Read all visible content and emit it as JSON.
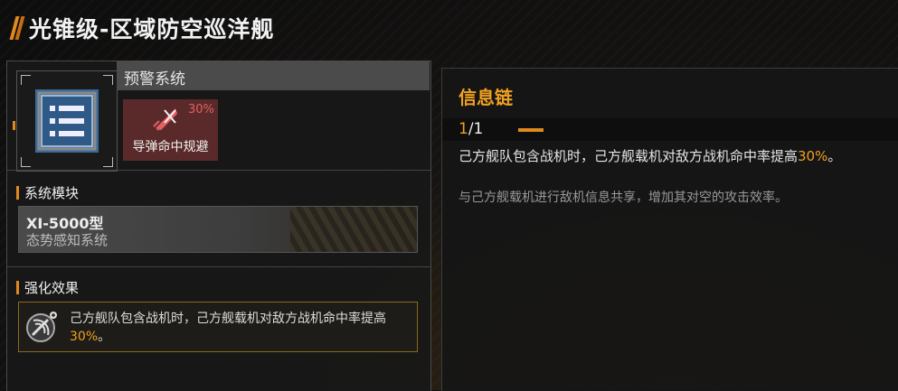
{
  "ship_title": "光锥级-区域防空巡洋舰",
  "system": {
    "name": "预警系统",
    "icon": "list-icon",
    "effect_card": {
      "percent": "30%",
      "label": "导弹命中规避",
      "icon": "missile-icon"
    }
  },
  "module_section": {
    "heading": "系统模块",
    "module_name": "XI-5000型",
    "module_desc": "态势感知系统"
  },
  "enhance_section": {
    "heading": "强化效果",
    "icon": "radar-icon",
    "text_before": "己方舰队包含战机时，己方舰载机对敌方战机命中率提高",
    "highlight": "30%",
    "text_after": "。"
  },
  "info_chain": {
    "title": "信息链",
    "level_current": "1",
    "level_rest": "/1",
    "desc_before": "己方舰队包含战机时，己方舰载机对敌方战机命中率提高",
    "desc_highlight": "30%",
    "desc_after": "。",
    "flavor": "与己方舰载机进行敌机信息共享，增加其对空的攻击效率。"
  },
  "colors": {
    "accent": "#e08a1e",
    "highlight": "#f0a020",
    "icon_blue": "#3c6a9a",
    "warn_red": "#5a2a2a"
  }
}
